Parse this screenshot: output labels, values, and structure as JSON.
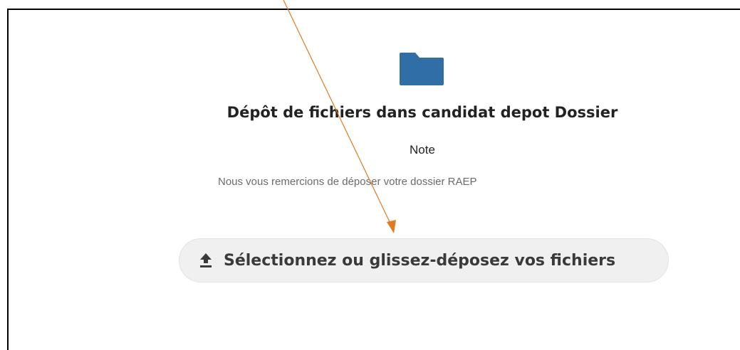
{
  "share": {
    "folder_icon": "folder-icon",
    "folder_color": "#2f6fa6",
    "title": "Dépôt de fichiers dans candidat depot Dossier",
    "note_label": "Note",
    "note_text": "Nous vous remercions de déposer votre dossier RAEP"
  },
  "upload": {
    "icon": "upload-icon",
    "label": "Sélectionnez ou glissez-déposez vos fichiers"
  },
  "annotation": {
    "arrow_color": "#e07b1f"
  }
}
